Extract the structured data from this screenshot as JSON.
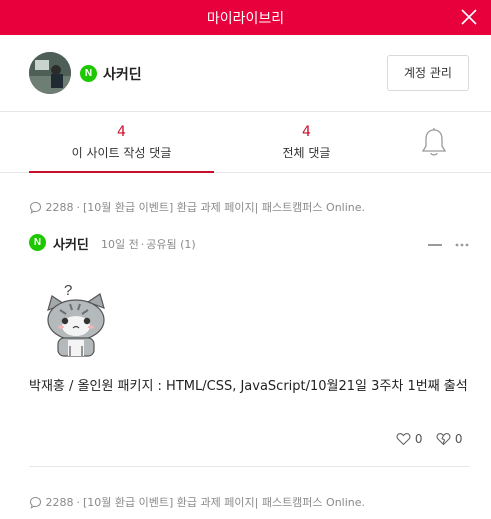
{
  "header": {
    "title": "마이라이브리",
    "close_icon": "close-icon",
    "bg_color": "#e8003c"
  },
  "profile": {
    "name": "사커딘",
    "badge": "N",
    "account_button": "계정 관리"
  },
  "tabs": [
    {
      "count": "4",
      "label": "이 사이트 작성 댓글",
      "active": true
    },
    {
      "count": "4",
      "label": "전체 댓글",
      "active": false
    }
  ],
  "bell_icon": "bell-icon",
  "comments": [
    {
      "count": "2288",
      "source": "[10월 환급 이벤트] 환급 과제 페이지| 패스트캠퍼스 Online.",
      "author": "사커딘",
      "badge": "N",
      "time": "10일 전",
      "visibility": "공유됨 (1)",
      "text": "박재홍 / 올인원 패키지 : HTML/CSS, JavaScript/10월21일 3주차 1번째 출석",
      "likes": "0",
      "dislikes": "0"
    },
    {
      "count": "2288",
      "source": "[10월 환급 이벤트] 환급 과제 페이지| 패스트캠퍼스 Online."
    }
  ],
  "colors": {
    "accent": "#c8102e",
    "naver_green": "#1ec800"
  }
}
